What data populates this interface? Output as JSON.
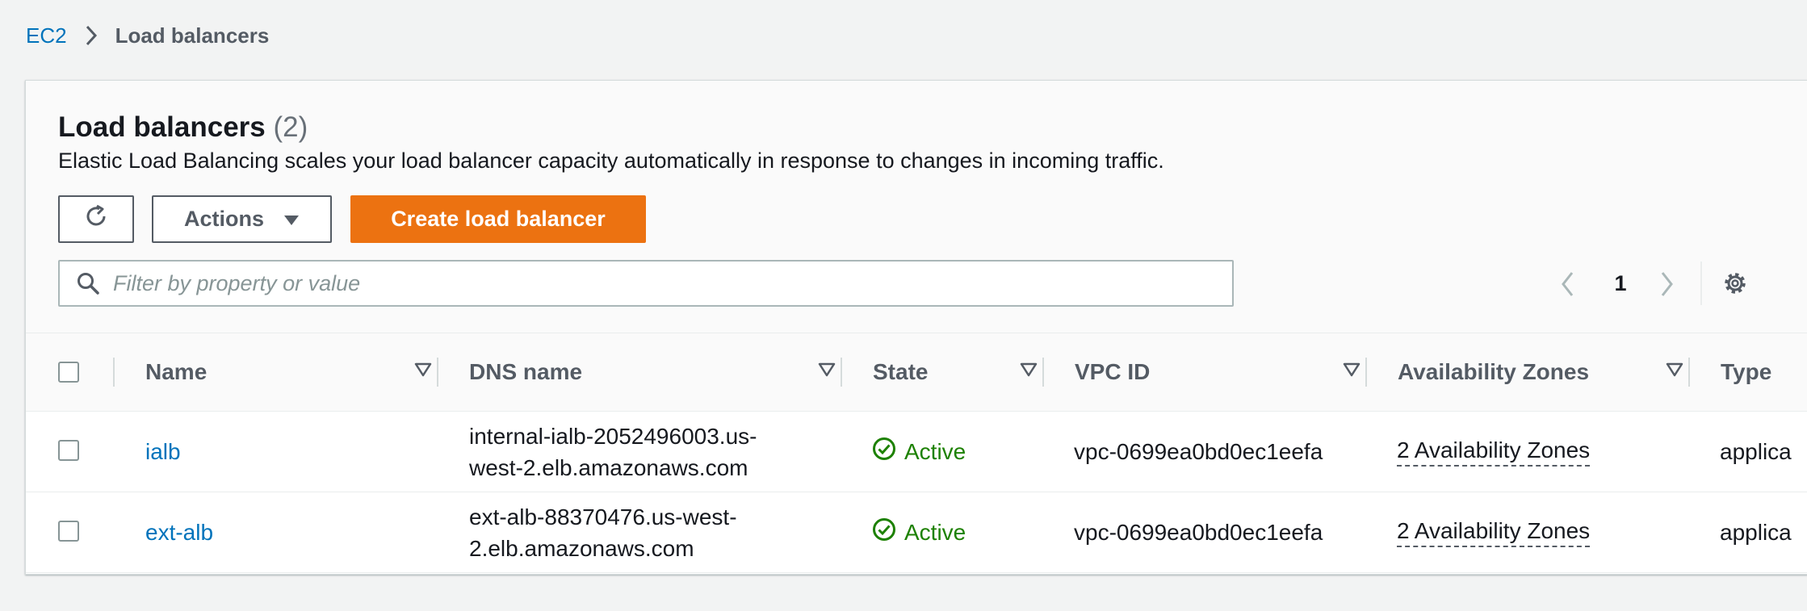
{
  "breadcrumb": {
    "parent": "EC2",
    "current": "Load balancers"
  },
  "panel": {
    "title": "Load balancers",
    "count": "(2)",
    "description": "Elastic Load Balancing scales your load balancer capacity automatically in response to changes in incoming traffic."
  },
  "toolbar": {
    "actions_label": "Actions",
    "create_label": "Create load balancer"
  },
  "filter": {
    "placeholder": "Filter by property or value"
  },
  "pagination": {
    "current_page": "1"
  },
  "table": {
    "columns": [
      "Name",
      "DNS name",
      "State",
      "VPC ID",
      "Availability Zones",
      "Type"
    ],
    "rows": [
      {
        "name": "ialb",
        "dns": "internal-ialb-2052496003.us-west-2.elb.amazonaws.com",
        "state": "Active",
        "vpc_id": "vpc-0699ea0bd0ec1eefa",
        "availability_zones": "2 Availability Zones",
        "type": "applica"
      },
      {
        "name": "ext-alb",
        "dns": "ext-alb-88370476.us-west-2.elb.amazonaws.com",
        "state": "Active",
        "vpc_id": "vpc-0699ea0bd0ec1eefa",
        "availability_zones": "2 Availability Zones",
        "type": "applica"
      }
    ]
  },
  "colors": {
    "link": "#0073bb",
    "primary": "#ec7211",
    "success": "#1d8102",
    "text": "#16191f",
    "secondary_text": "#545b64"
  }
}
